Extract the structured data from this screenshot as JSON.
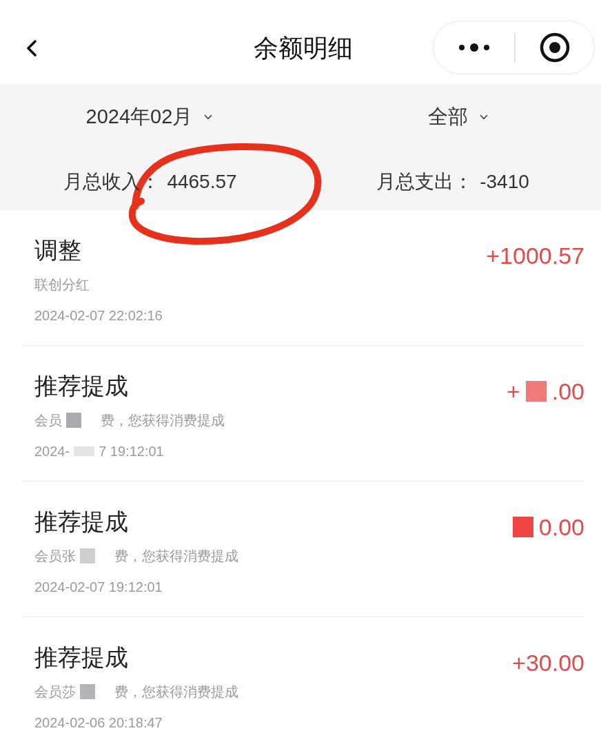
{
  "nav": {
    "title": "余额明细"
  },
  "filters": [
    {
      "label": "2024年02月"
    },
    {
      "label": "全部"
    }
  ],
  "summary": [
    {
      "label": "月总收入：",
      "value": "4465.57"
    },
    {
      "label": "月总支出：",
      "value": "-3410"
    }
  ],
  "annotation": {
    "kind": "hand-drawn-circle"
  },
  "records": [
    {
      "title": "调整",
      "description": [
        {
          "kind": "text",
          "text": "联创分红"
        }
      ],
      "date": [
        {
          "kind": "text",
          "text": "2024-02-07 22:02:16"
        }
      ],
      "amount": [
        {
          "kind": "text",
          "text": "+1000.57"
        }
      ]
    },
    {
      "title": "推荐提成",
      "description": [
        {
          "kind": "text",
          "text": "会员"
        },
        {
          "kind": "mosaic",
          "color": "#a9a9b0"
        },
        {
          "kind": "text",
          "text": "费，您获得消费提成"
        }
      ],
      "date": [
        {
          "kind": "text",
          "text": "2024-"
        },
        {
          "kind": "mosaic",
          "color": "#e4e4e4"
        },
        {
          "kind": "text",
          "text": "7 19:12:01"
        }
      ],
      "amount": [
        {
          "kind": "text",
          "text": "+"
        },
        {
          "kind": "mosaic",
          "color": "#ee7a7a"
        },
        {
          "kind": "text",
          "text": ".00"
        }
      ]
    },
    {
      "title": "推荐提成",
      "description": [
        {
          "kind": "text",
          "text": "会员张"
        },
        {
          "kind": "mosaic",
          "color": "#cfcfcf"
        },
        {
          "kind": "text",
          "text": "费，您获得消费提成"
        }
      ],
      "date": [
        {
          "kind": "text",
          "text": "2024-02-07 19:12:01"
        }
      ],
      "amount": [
        {
          "kind": "mosaic",
          "color": "#f04545"
        },
        {
          "kind": "text",
          "text": "0.00"
        }
      ]
    },
    {
      "title": "推荐提成",
      "description": [
        {
          "kind": "text",
          "text": "会员莎"
        },
        {
          "kind": "mosaic",
          "color": "#b4b4b8"
        },
        {
          "kind": "text",
          "text": "费，您获得消费提成"
        }
      ],
      "date": [
        {
          "kind": "text",
          "text": "2024-02-06 20:18:47"
        }
      ],
      "amount": [
        {
          "kind": "text",
          "text": "+30.00"
        }
      ]
    }
  ]
}
